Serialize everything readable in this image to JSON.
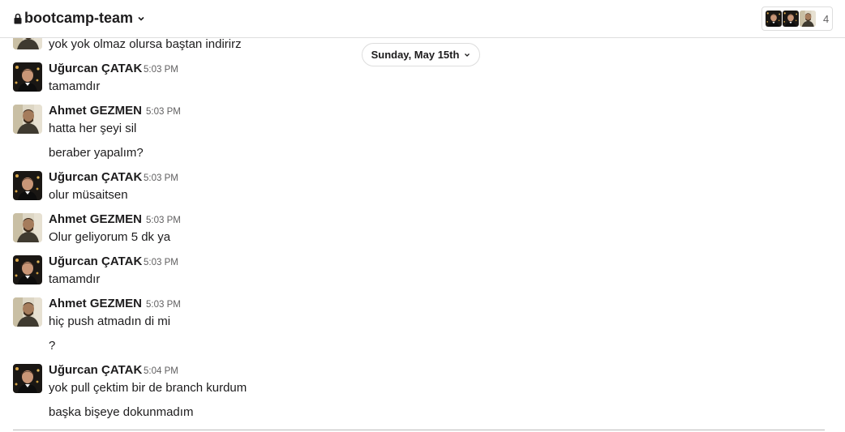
{
  "header": {
    "channel_name": "bootcamp-team",
    "member_count": "4",
    "lock_icon": "lock-icon",
    "chevron_icon": "chevron-down-icon"
  },
  "date_divider": {
    "label": "Sunday, May 15th"
  },
  "partial_message": {
    "text": "yok yok olmaz olursa baştan indirirz"
  },
  "messages": [
    {
      "author": "Uğurcan ÇATAK",
      "time": "5:03 PM",
      "lines": [
        "tamamdır"
      ]
    },
    {
      "author": "Ahmet GEZMEN",
      "time": "5:03 PM",
      "lines": [
        "hatta her şeyi sil",
        "beraber yapalım?"
      ]
    },
    {
      "author": "Uğurcan ÇATAK",
      "time": "5:03 PM",
      "lines": [
        "olur müsaitsen"
      ]
    },
    {
      "author": "Ahmet GEZMEN",
      "time": "5:03 PM",
      "lines": [
        "Olur geliyorum 5 dk ya"
      ]
    },
    {
      "author": "Uğurcan ÇATAK",
      "time": "5:03 PM",
      "lines": [
        "tamamdır"
      ]
    },
    {
      "author": "Ahmet GEZMEN",
      "time": "5:03 PM",
      "lines": [
        "hiç push atmadın di mi",
        "?"
      ]
    },
    {
      "author": "Uğurcan ÇATAK",
      "time": "5:04 PM",
      "lines": [
        "yok pull çektim bir de branch kurdum",
        "başka bişeye dokunmadım"
      ]
    }
  ]
}
